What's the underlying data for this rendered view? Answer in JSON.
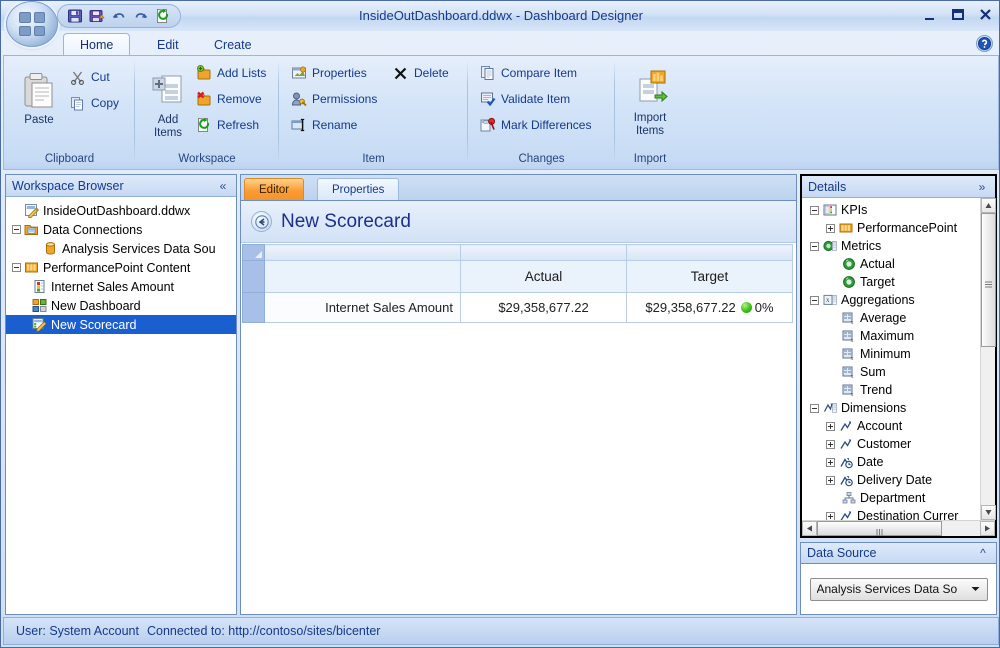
{
  "window": {
    "title": "InsideOutDashboard.ddwx - Dashboard Designer",
    "minimize_label": "Minimize",
    "maximize_label": "Maximize",
    "close_label": "Close"
  },
  "quick_access": [
    {
      "name": "save-icon",
      "tooltip": "Save"
    },
    {
      "name": "save-as-icon",
      "tooltip": "Save As"
    },
    {
      "name": "undo-icon",
      "tooltip": "Undo"
    },
    {
      "name": "redo-icon",
      "tooltip": "Redo"
    },
    {
      "name": "refresh-icon",
      "tooltip": "Refresh"
    }
  ],
  "ribbon": {
    "tabs": [
      {
        "label": "Home",
        "active": true
      },
      {
        "label": "Edit",
        "active": false
      },
      {
        "label": "Create",
        "active": false
      }
    ],
    "help_label": "Help",
    "groups": [
      {
        "label": "Clipboard",
        "big": [
          {
            "label": "Paste",
            "icon": "paste-icon"
          }
        ],
        "small": [
          {
            "label": "Cut",
            "icon": "cut-icon"
          },
          {
            "label": "Copy",
            "icon": "copy-icon"
          }
        ]
      },
      {
        "label": "Workspace",
        "big": [
          {
            "label": "Add Items",
            "icon": "add-items-icon"
          }
        ],
        "small": [
          {
            "label": "Add Lists",
            "icon": "add-lists-icon"
          },
          {
            "label": "Remove",
            "icon": "remove-icon"
          },
          {
            "label": "Refresh",
            "icon": "refresh-icon"
          }
        ]
      },
      {
        "label": "Item",
        "small": [
          {
            "label": "Properties",
            "icon": "properties-icon"
          },
          {
            "label": "Delete",
            "icon": "delete-icon"
          },
          {
            "label": "Permissions",
            "icon": "permissions-icon"
          },
          {
            "label": "Rename",
            "icon": "rename-icon"
          }
        ]
      },
      {
        "label": "Changes",
        "small": [
          {
            "label": "Compare Item",
            "icon": "compare-item-icon"
          },
          {
            "label": "Validate Item",
            "icon": "validate-item-icon"
          },
          {
            "label": "Mark Differences",
            "icon": "mark-differences-icon"
          }
        ]
      },
      {
        "label": "Import",
        "big": [
          {
            "label": "Import Items",
            "icon": "import-items-icon"
          }
        ]
      }
    ]
  },
  "workspace_browser": {
    "title": "Workspace Browser",
    "collapse_label": "«",
    "items": [
      {
        "label": "InsideOutDashboard.ddwx",
        "icon": "workspace-file-icon",
        "indent": 0,
        "expander": "none",
        "selected": false
      },
      {
        "label": "Data Connections",
        "icon": "folder-data-icon",
        "indent": 0,
        "expander": "minus",
        "selected": false
      },
      {
        "label": "Analysis Services Data Sou",
        "icon": "datasource-icon",
        "indent": 2,
        "expander": "none",
        "selected": false
      },
      {
        "label": "PerformancePoint Content",
        "icon": "content-list-icon",
        "indent": 0,
        "expander": "minus",
        "selected": false
      },
      {
        "label": "Internet Sales Amount",
        "icon": "kpi-icon",
        "indent": 1,
        "expander": "none",
        "selected": false
      },
      {
        "label": "New Dashboard",
        "icon": "dashboard-icon",
        "indent": 1,
        "expander": "none",
        "selected": false
      },
      {
        "label": "New Scorecard",
        "icon": "scorecard-icon",
        "indent": 1,
        "expander": "none",
        "selected": true
      }
    ]
  },
  "editor": {
    "tabs": [
      {
        "label": "Editor",
        "active": true
      },
      {
        "label": "Properties",
        "active": false
      }
    ],
    "back_label": "Back",
    "title": "New Scorecard",
    "scorecard": {
      "columns": [
        "",
        "Actual",
        "Target"
      ],
      "rows": [
        {
          "name": "Internet Sales Amount",
          "actual": "$29,358,677.22",
          "target": "$29,358,677.22",
          "indicator": "green-dot",
          "score": "0%"
        }
      ]
    }
  },
  "details": {
    "title": "Details",
    "expand_label": "»",
    "tree": [
      {
        "label": "KPIs",
        "icon": "kpis-folder-icon",
        "indent": 0,
        "expander": "minus"
      },
      {
        "label": "PerformancePoint",
        "icon": "performancepoint-icon",
        "indent": 1,
        "expander": "plus"
      },
      {
        "label": "Metrics",
        "icon": "metrics-folder-icon",
        "indent": 0,
        "expander": "minus"
      },
      {
        "label": "Actual",
        "icon": "metric-icon",
        "indent": 1,
        "expander": "none"
      },
      {
        "label": "Target",
        "icon": "metric-icon",
        "indent": 1,
        "expander": "none"
      },
      {
        "label": "Aggregations",
        "icon": "aggregations-folder-icon",
        "indent": 0,
        "expander": "minus"
      },
      {
        "label": "Average",
        "icon": "aggregation-icon",
        "indent": 1,
        "expander": "none"
      },
      {
        "label": "Maximum",
        "icon": "aggregation-icon",
        "indent": 1,
        "expander": "none"
      },
      {
        "label": "Minimum",
        "icon": "aggregation-icon",
        "indent": 1,
        "expander": "none"
      },
      {
        "label": "Sum",
        "icon": "aggregation-icon",
        "indent": 1,
        "expander": "none"
      },
      {
        "label": "Trend",
        "icon": "aggregation-icon",
        "indent": 1,
        "expander": "none"
      },
      {
        "label": "Dimensions",
        "icon": "dimensions-folder-icon",
        "indent": 0,
        "expander": "minus"
      },
      {
        "label": "Account",
        "icon": "dimension-icon",
        "indent": 1,
        "expander": "plus"
      },
      {
        "label": "Customer",
        "icon": "dimension-icon",
        "indent": 1,
        "expander": "plus"
      },
      {
        "label": "Date",
        "icon": "time-dimension-icon",
        "indent": 1,
        "expander": "plus"
      },
      {
        "label": "Delivery Date",
        "icon": "time-dimension-icon",
        "indent": 1,
        "expander": "plus"
      },
      {
        "label": "Department",
        "icon": "department-dimension-icon",
        "indent": 1,
        "expander": "none"
      },
      {
        "label": "Destination Currer",
        "icon": "dimension-icon",
        "indent": 1,
        "expander": "plus"
      }
    ]
  },
  "data_source": {
    "title": "Data Source",
    "collapse_label": "»",
    "selected": "Analysis Services Data So"
  },
  "status_bar": {
    "user_label": "User: System Account",
    "connection_label": "Connected to: http://contoso/sites/bicenter"
  },
  "colors": {
    "accent_blue": "#15398c",
    "selection_blue": "#1a5fd0",
    "tab_active_orange": "#fb9b32",
    "indicator_green": "#37bf1c"
  }
}
